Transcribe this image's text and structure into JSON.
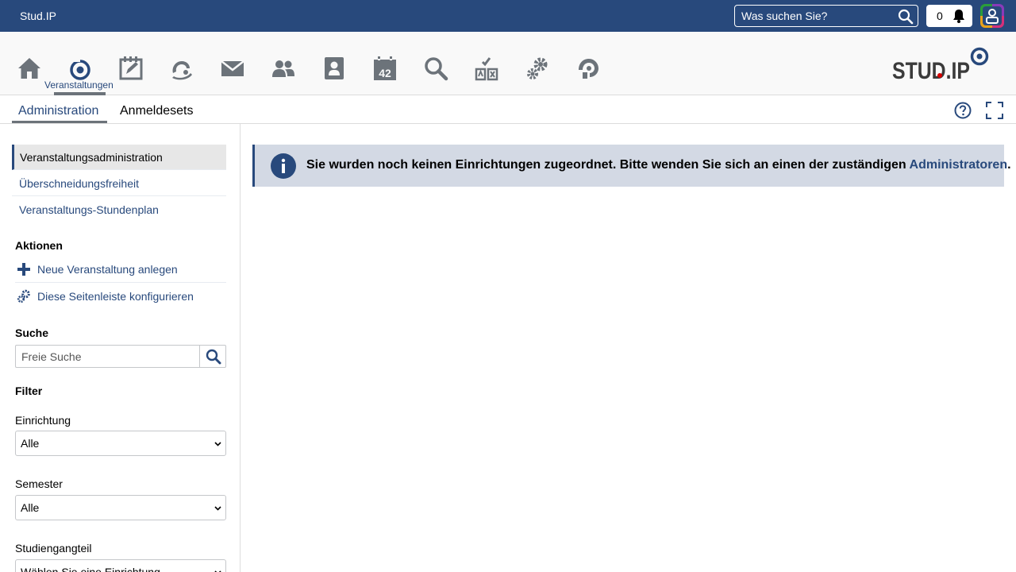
{
  "topbar": {
    "brand": "Stud.IP",
    "search_placeholder": "Was suchen Sie?",
    "notification_count": "0"
  },
  "nav": {
    "active_label": "Veranstaltungen",
    "logo_text": "STUD.IP",
    "icons": [
      "home-icon",
      "seminar-icon",
      "studies-icon",
      "community-icon",
      "mail-icon",
      "community-people-icon",
      "profile-icon",
      "schedule-icon",
      "search-icon",
      "tools-icon",
      "admin-icon",
      "resources-icon"
    ]
  },
  "tabs": {
    "admin": "Administration",
    "sets": "Anmeldesets"
  },
  "sidebar": {
    "nav_items": [
      "Veranstaltungsadministration",
      "Überschneidungsfreiheit",
      "Veranstaltungs-Stundenplan"
    ],
    "actions_heading": "Aktionen",
    "actions": [
      "Neue Veranstaltung anlegen",
      "Diese Seitenleiste konfigurieren"
    ],
    "search_heading": "Suche",
    "search_placeholder": "Freie Suche",
    "filter_heading": "Filter",
    "filters": [
      {
        "label": "Einrichtung",
        "value": "Alle"
      },
      {
        "label": "Semester",
        "value": "Alle"
      },
      {
        "label": "Studiengangteil",
        "value": "Wählen Sie eine Einrichtung"
      }
    ]
  },
  "message": {
    "text": "Sie wurden noch keinen Einrichtungen zugeordnet. Bitte wenden Sie sich an einen der zuständigen ",
    "link": "Administratoren",
    "suffix": "."
  },
  "colors": {
    "brand": "#28497c",
    "info_bg": "#d3d9e4",
    "icon_gray": "#6c737a",
    "accent_red": "#d60000"
  }
}
